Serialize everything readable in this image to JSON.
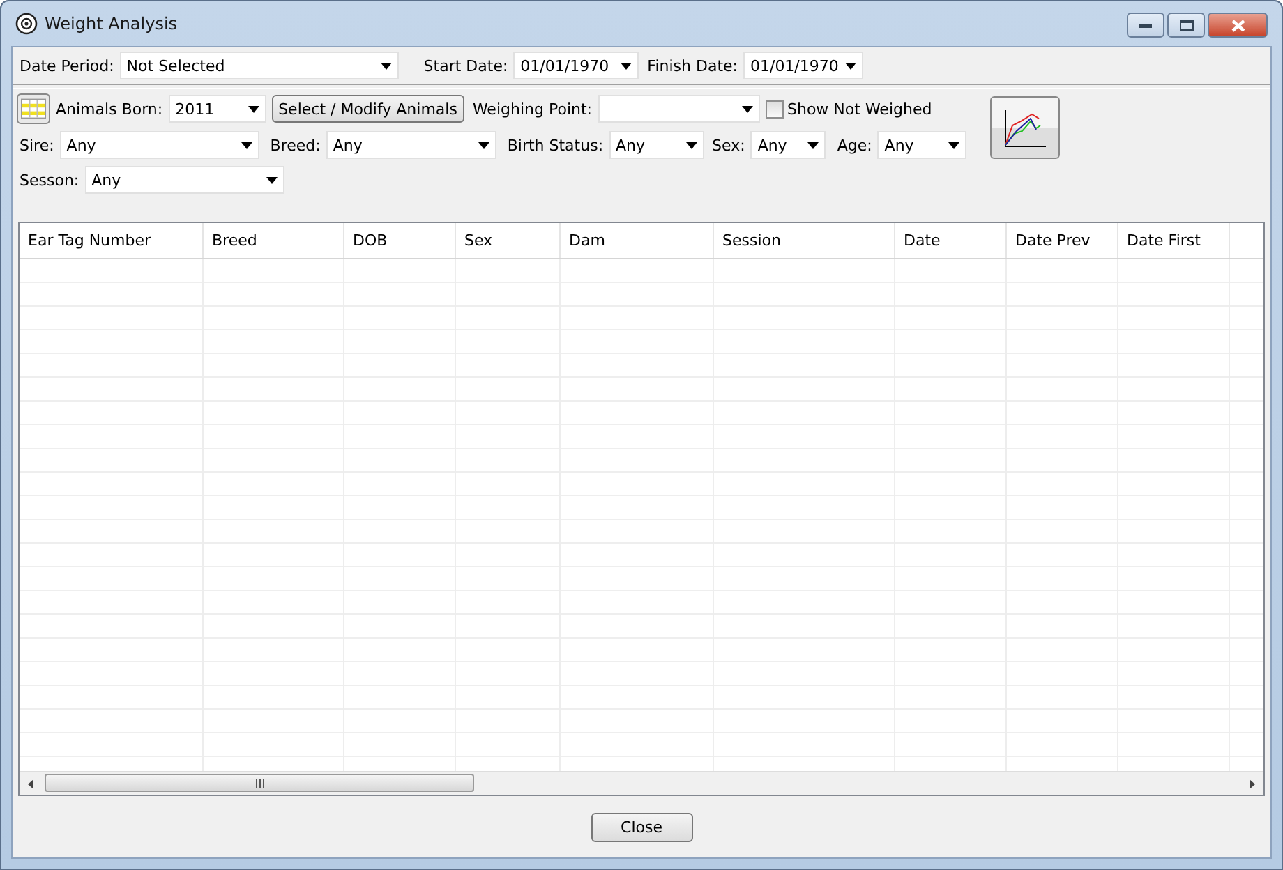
{
  "window": {
    "title": "Weight Analysis"
  },
  "date_row": [
    {
      "label": "Date Period:",
      "value": "Not Selected"
    },
    {
      "label": "Start Date:",
      "value": "01/01/1970"
    },
    {
      "label": "Finish Date:",
      "value": "01/01/1970"
    }
  ],
  "animals_born": {
    "label": "Animals Born:",
    "value": "2011"
  },
  "select_button": "Select / Modify Animals",
  "weighing_point": {
    "label": "Weighing Point:"
  },
  "show_not_weighed": {
    "label": "Show Not Weighed",
    "checked": false
  },
  "filters": [
    {
      "label": "Sire:",
      "value": "Any"
    },
    {
      "label": "Breed:",
      "value": "Any"
    },
    {
      "label": "Birth Status:",
      "value": "Any"
    },
    {
      "label": "Sex:",
      "value": "Any"
    },
    {
      "label": "Age:",
      "value": "Any"
    }
  ],
  "session": {
    "label": "Sesson:",
    "value": "Any"
  },
  "table": {
    "columns": [
      {
        "label": "Ear Tag Number"
      },
      {
        "label": "Breed"
      },
      {
        "label": "DOB"
      },
      {
        "label": "Sex"
      },
      {
        "label": "Dam"
      },
      {
        "label": "Session"
      },
      {
        "label": "Date"
      },
      {
        "label": "Date Prev"
      },
      {
        "label": "Date First"
      }
    ]
  },
  "buttons": [
    "Close"
  ]
}
